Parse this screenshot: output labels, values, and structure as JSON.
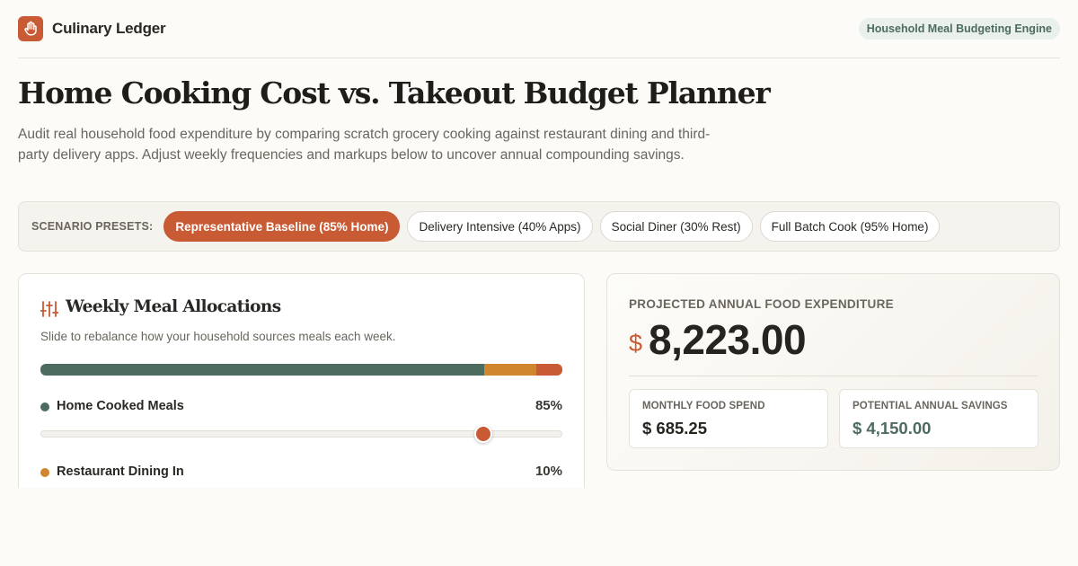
{
  "brand": {
    "name": "Culinary Ledger",
    "badge": "Household Meal Budgeting Engine"
  },
  "colors": {
    "accent": "#c85a34",
    "home": "#4d6c5f",
    "restaurant": "#d0862f",
    "delivery": "#c85a34"
  },
  "page": {
    "title": "Home Cooking Cost vs. Takeout Budget Planner",
    "description": "Audit real household food expenditure by comparing scratch grocery cooking against restaurant dining and third-party delivery apps. Adjust weekly frequencies and markups below to uncover annual compounding savings."
  },
  "presets": {
    "label": "SCENARIO PRESETS:",
    "items": [
      {
        "label": "Representative Baseline (85% Home)",
        "active": true
      },
      {
        "label": "Delivery Intensive (40% Apps)",
        "active": false
      },
      {
        "label": "Social Diner (30% Rest)",
        "active": false
      },
      {
        "label": "Full Batch Cook (95% Home)",
        "active": false
      }
    ]
  },
  "allocations": {
    "title": "Weekly Meal Allocations",
    "subtitle": "Slide to rebalance how your household sources meals each week.",
    "icon": "sliders-icon",
    "items": [
      {
        "label": "Home Cooked Meals",
        "pct_label": "85%",
        "pct": 85
      },
      {
        "label": "Restaurant Dining In",
        "pct_label": "10%",
        "pct": 10
      },
      {
        "pct": 5
      }
    ]
  },
  "summary": {
    "projected_label": "PROJECTED ANNUAL FOOD EXPENDITURE",
    "currency": "$",
    "projected_value": "8,223.00",
    "monthly_label": "MONTHLY FOOD SPEND",
    "monthly_value": "$ 685.25",
    "savings_label": "POTENTIAL ANNUAL SAVINGS",
    "savings_value": "$ 4,150.00"
  }
}
